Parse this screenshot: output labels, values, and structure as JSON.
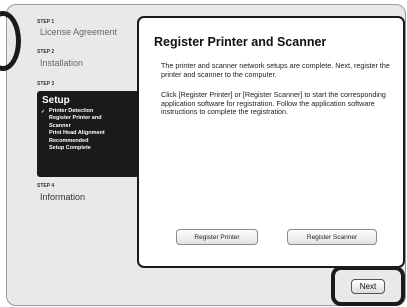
{
  "sidebar": {
    "steps": [
      {
        "label": "STEP 1",
        "title": "License Agreement"
      },
      {
        "label": "STEP 2",
        "title": "Installation"
      },
      {
        "label": "STEP 3",
        "title": "Setup",
        "substeps": [
          "Printer Detection",
          "Register Printer and",
          "Scanner",
          "Print Head Alignment",
          "Recommended",
          "Setup Complete"
        ],
        "check": "✓"
      },
      {
        "label": "STEP 4",
        "title": "Information"
      }
    ]
  },
  "main": {
    "title": "Register Printer and Scanner",
    "paragraphs": [
      "The printer and scanner network setups are complete. Next, register the printer and scanner to the computer.",
      "Click [Register Printer] or [Register Scanner] to start the corresponding application software for registration. Follow the application software instructions to complete the registration."
    ],
    "buttons": {
      "register_printer": "Register Printer",
      "register_scanner": "Register Scanner"
    }
  },
  "footer": {
    "next_label": "Next"
  }
}
